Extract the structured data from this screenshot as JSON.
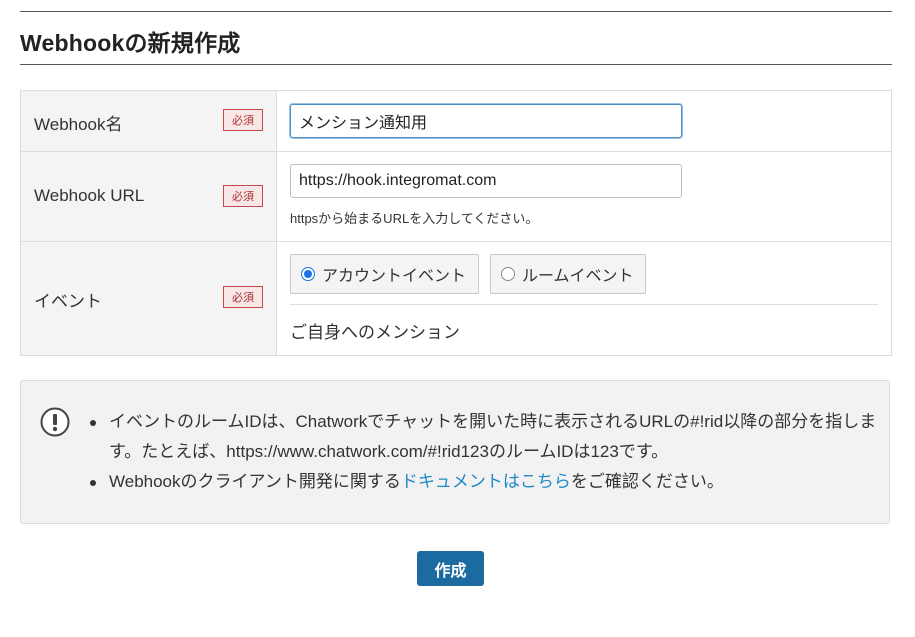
{
  "page": {
    "title": "Webhookの新規作成"
  },
  "form": {
    "required_label": "必須",
    "name": {
      "label": "Webhook名",
      "value": "メンション通知用"
    },
    "url": {
      "label": "Webhook URL",
      "value": "https://hook.integromat.com",
      "hint": "httpsから始まるURLを入力してください。"
    },
    "event": {
      "label": "イベント",
      "options": [
        {
          "label": "アカウントイベント",
          "checked": true
        },
        {
          "label": "ルームイベント",
          "checked": false
        }
      ],
      "description": "ご自身へのメンション"
    }
  },
  "notice": {
    "icon": "exclamation-circle-icon",
    "item1": "イベントのルームIDは、Chatworkでチャットを開いた時に表示されるURLの#!rid以降の部分を指します。たとえば、https://www.chatwork.com/#!rid123のルームIDは123です。",
    "item2_prefix": "Webhookのクライアント開発に関する",
    "item2_link": "ドキュメントはこちら",
    "item2_suffix": "をご確認ください。"
  },
  "actions": {
    "create_label": "作成"
  },
  "colors": {
    "primary_button": "#1b6aa0",
    "link": "#1e88c8",
    "required_border": "#c24a4a",
    "focus": "#4a90c8"
  }
}
